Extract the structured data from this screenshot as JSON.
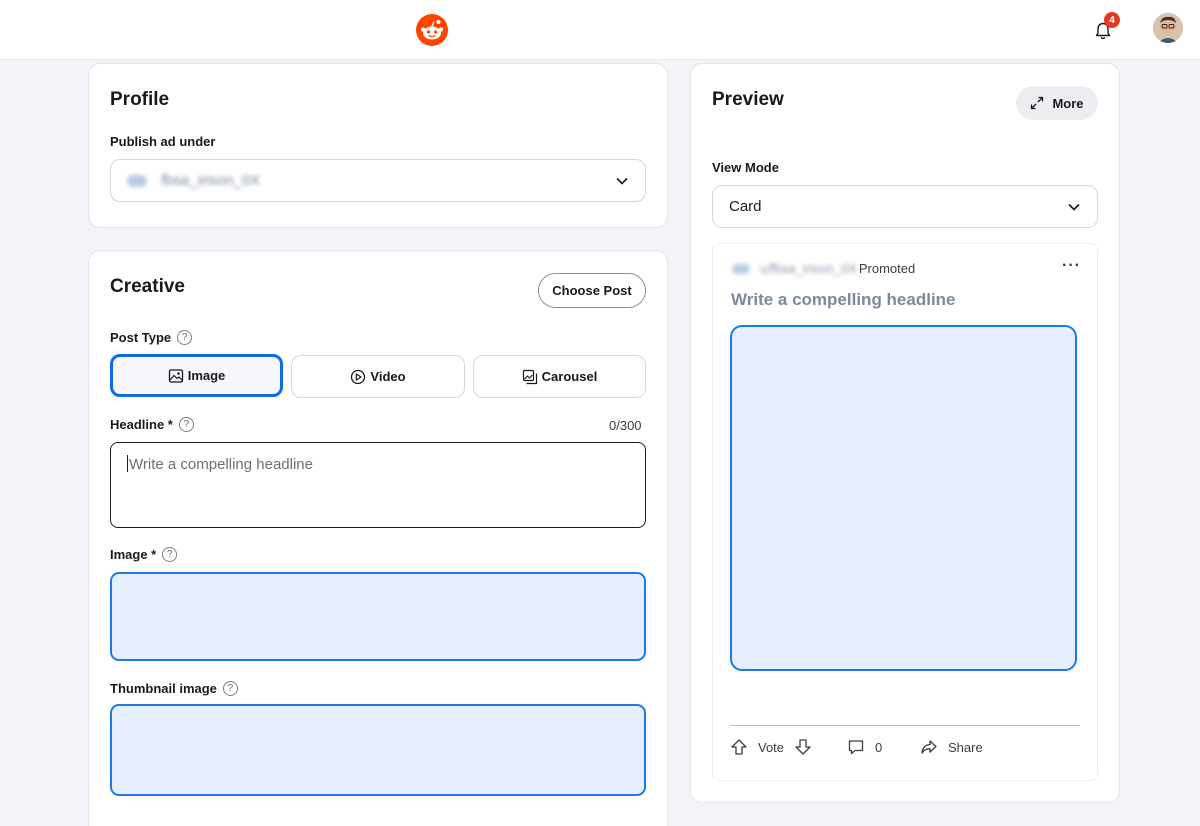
{
  "topbar": {
    "notification_count": "4"
  },
  "profile": {
    "title": "Profile",
    "publish_label": "Publish ad under",
    "account_name": "fbsa_irison_0X"
  },
  "creative": {
    "title": "Creative",
    "choose_post": "Choose Post",
    "post_type_label": "Post Type",
    "post_types": [
      {
        "label": "Image",
        "icon": "image-icon",
        "selected": true
      },
      {
        "label": "Video",
        "icon": "video-play-icon",
        "selected": false
      },
      {
        "label": "Carousel",
        "icon": "carousel-icon",
        "selected": false
      }
    ],
    "headline_label": "Headline *",
    "headline_counter": "0/300",
    "headline_placeholder": "Write a compelling headline",
    "image_label": "Image *",
    "thumbnail_label": "Thumbnail image"
  },
  "preview": {
    "title": "Preview",
    "more": "More",
    "view_mode_label": "View Mode",
    "view_mode_value": "Card",
    "account_name": "u/fbsa_irison_0X",
    "promoted": "Promoted",
    "headline": "Write a compelling headline",
    "vote": "Vote",
    "comments": "0",
    "share": "Share"
  },
  "colors": {
    "accent": "#0e6be6",
    "drop_fill": "#e7eefe",
    "brand": "#ff4500"
  }
}
